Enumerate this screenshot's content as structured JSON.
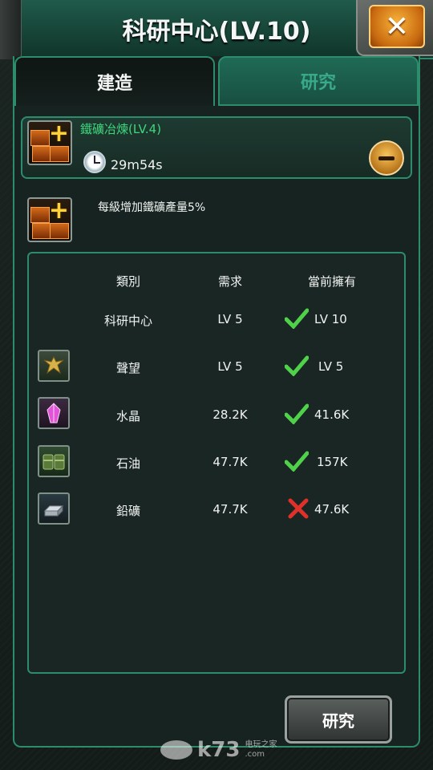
{
  "header": {
    "title": "科研中心(LV.10)",
    "close_label": "✕"
  },
  "tabs": [
    {
      "label": "建造",
      "active": false
    },
    {
      "label": "研究",
      "active": true
    }
  ],
  "queue": {
    "name": "鐵礦冶煉(LV.4)",
    "timer": "29m54s",
    "icon": "iron-smelting-icon"
  },
  "description": "每級增加鐵礦產量5%",
  "requirements": {
    "headers": {
      "category": "類別",
      "need": "需求",
      "have": "當前擁有"
    },
    "rows": [
      {
        "category": "科研中心",
        "need": "LV 5",
        "have": "LV 10",
        "met": true,
        "icon": ""
      },
      {
        "category": "聲望",
        "need": "LV 5",
        "have": "LV 5",
        "met": true,
        "icon": "eagle-emblem-icon"
      },
      {
        "category": "水晶",
        "need": "28.2K",
        "have": "41.6K",
        "met": true,
        "icon": "crystal-icon"
      },
      {
        "category": "石油",
        "need": "47.7K",
        "have": "157K",
        "met": true,
        "icon": "oil-barrel-icon"
      },
      {
        "category": "鉛礦",
        "need": "47.7K",
        "have": "47.6K",
        "met": false,
        "icon": "lead-ingot-icon"
      }
    ]
  },
  "research_button": "研究",
  "watermark": {
    "main": "k73",
    "sub": "电玩之家",
    "sub2": ".com"
  },
  "colors": {
    "accent": "#2c8c6c",
    "green_text": "#3ed67b",
    "check": "#4fd24a",
    "cross": "#e0302a"
  }
}
